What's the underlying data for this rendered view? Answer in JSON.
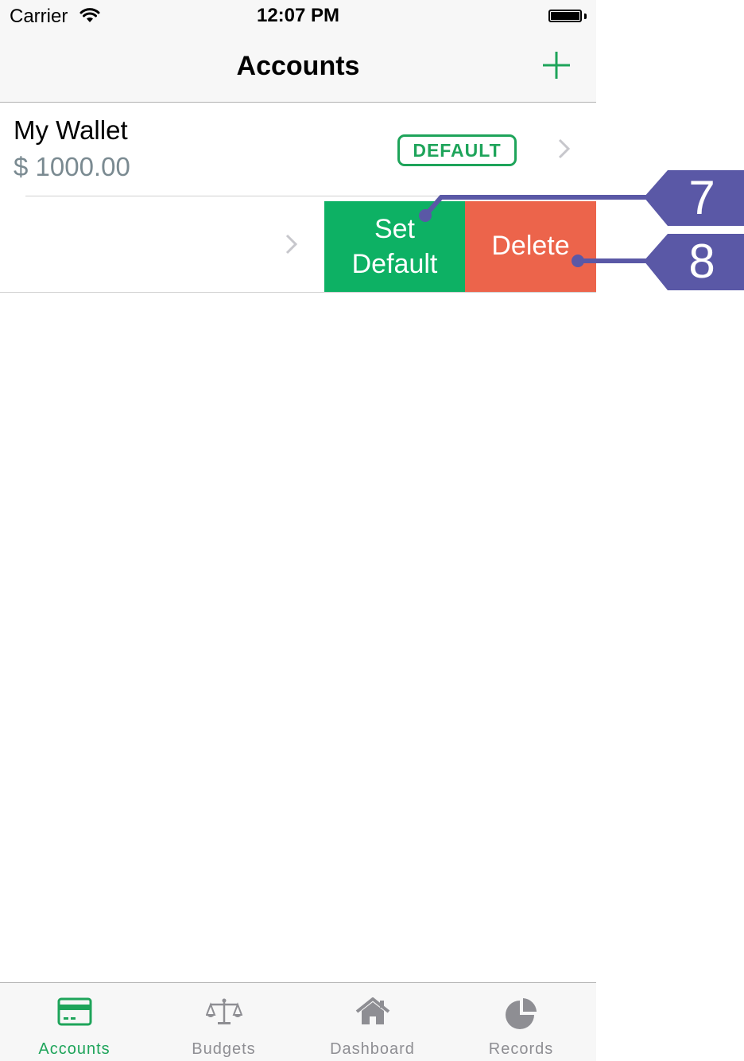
{
  "status_bar": {
    "carrier": "Carrier",
    "time": "12:07 PM"
  },
  "nav": {
    "title": "Accounts",
    "add_icon": "plus-icon"
  },
  "accounts": [
    {
      "name": "My Wallet",
      "balance": "$ 1000.00",
      "badge": "DEFAULT"
    }
  ],
  "swipe_actions": {
    "set_default": "Set Default",
    "delete": "Delete"
  },
  "tabs": [
    {
      "label": "Accounts",
      "icon": "credit-card-icon",
      "active": true
    },
    {
      "label": "Budgets",
      "icon": "scale-icon",
      "active": false
    },
    {
      "label": "Dashboard",
      "icon": "home-icon",
      "active": false
    },
    {
      "label": "Records",
      "icon": "pie-chart-icon",
      "active": false
    }
  ],
  "callouts": [
    "7",
    "8"
  ],
  "colors": {
    "accent_green": "#1ea45a",
    "set_default_bg": "#0db164",
    "delete_bg": "#ec644b",
    "callout": "#5a58a6",
    "balance_text": "#7a8a91"
  }
}
